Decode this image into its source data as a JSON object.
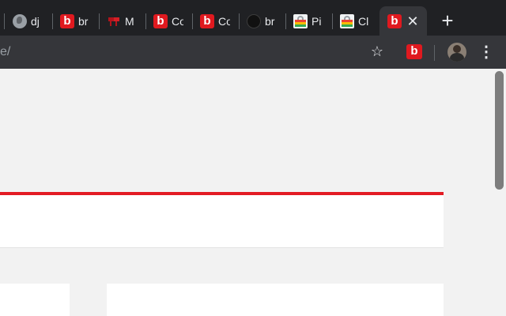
{
  "tabs": [
    {
      "label": "",
      "favicon": "tab-edge",
      "favicon_text": ""
    },
    {
      "label": "dj",
      "favicon": "globe-icon",
      "favicon_text": ""
    },
    {
      "label": "br",
      "favicon": "b-logo-icon",
      "favicon_text": "b"
    },
    {
      "label": "M",
      "favicon": "red-flag-icon",
      "favicon_text": ""
    },
    {
      "label": "Co",
      "favicon": "b-logo-icon",
      "favicon_text": "b"
    },
    {
      "label": "Co",
      "favicon": "b-logo-icon",
      "favicon_text": "b"
    },
    {
      "label": "br",
      "favicon": "dark-circle-icon",
      "favicon_text": ""
    },
    {
      "label": "Pi",
      "favicon": "shopping-bag-icon",
      "favicon_text": ""
    },
    {
      "label": "Cl",
      "favicon": "shopping-bag-icon",
      "favicon_text": ""
    },
    {
      "label": "",
      "favicon": "b-logo-icon",
      "favicon_text": "b",
      "active": true
    }
  ],
  "active_tab": {
    "favicon_text": "b",
    "close_glyph": "✕"
  },
  "new_tab_glyph": "+",
  "toolbar": {
    "url_fragment": "e/",
    "star_glyph": "☆",
    "extension_text": "b",
    "menu_glyph": "⋮"
  },
  "colors": {
    "chrome_dark": "#202124",
    "toolbar": "#35363a",
    "brand_red": "#e0191f",
    "page_bg": "#f2f2f2",
    "accent_line": "#e31b23"
  }
}
